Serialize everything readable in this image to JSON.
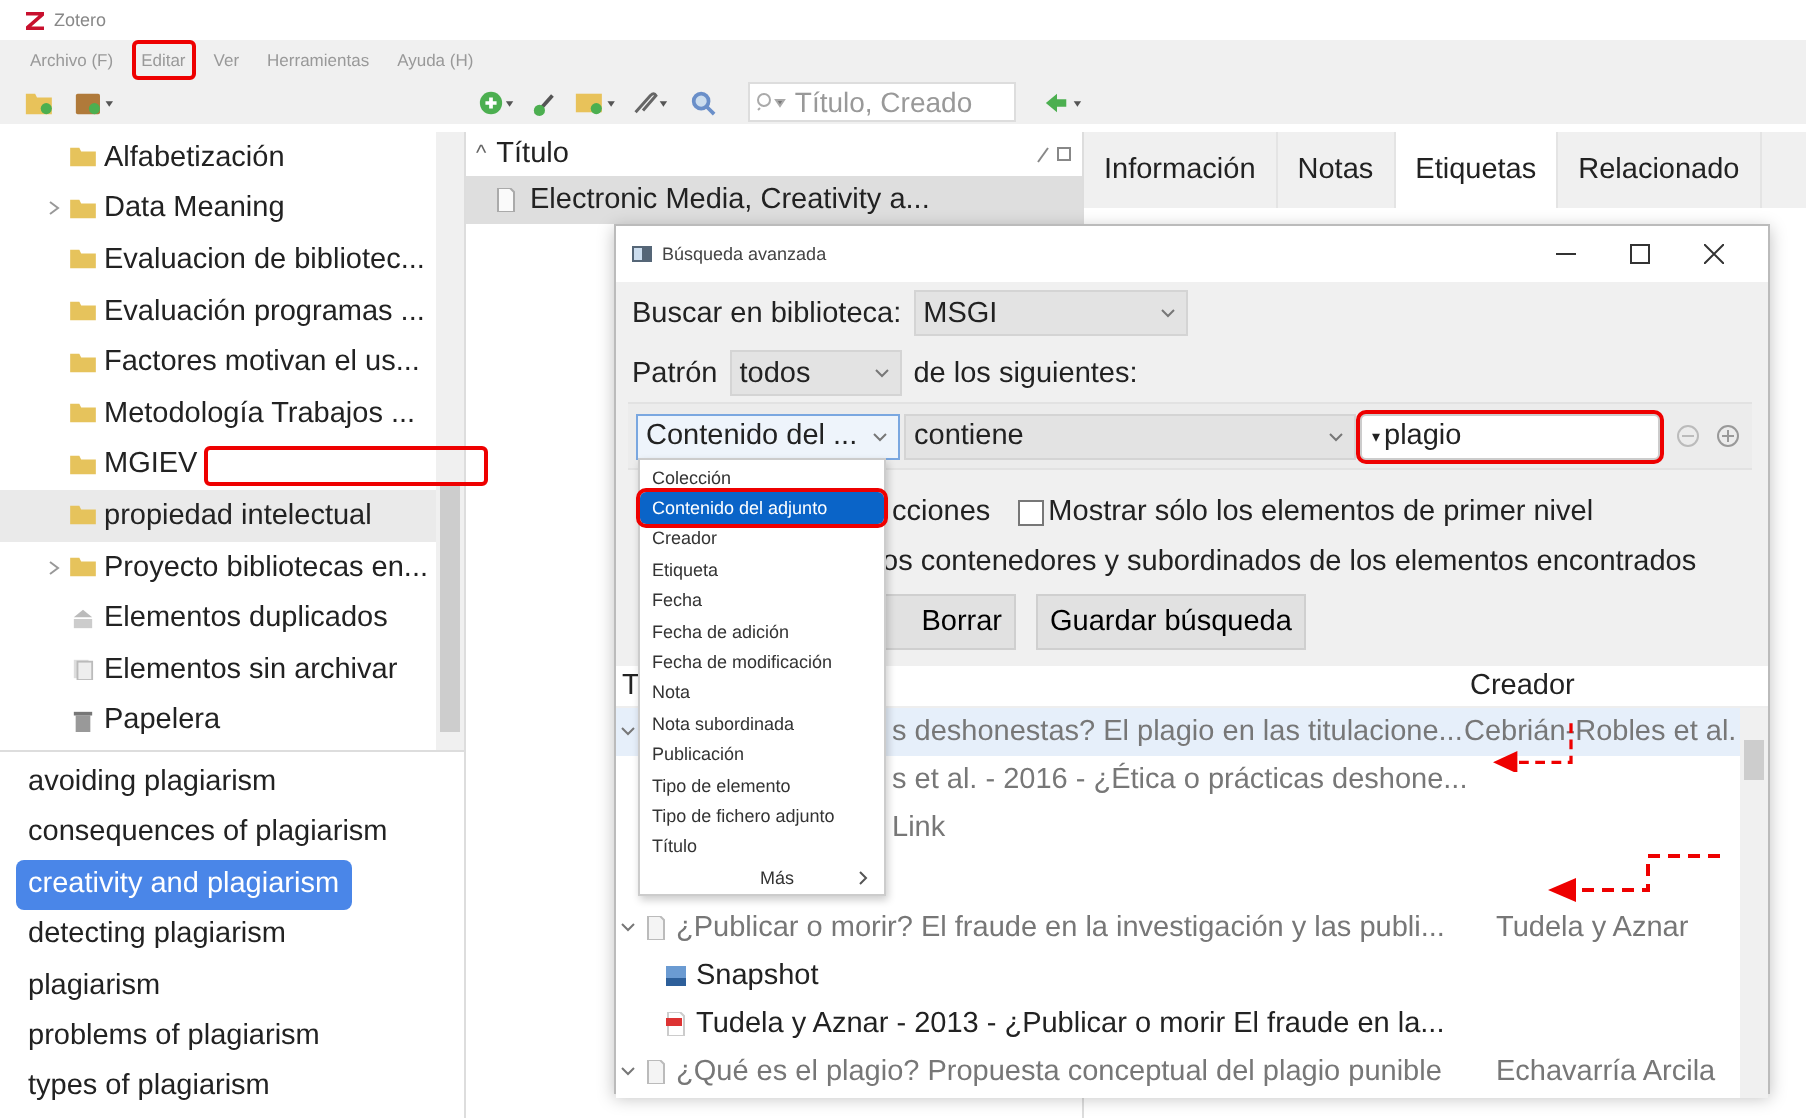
{
  "app_title": "Zotero",
  "menu": [
    {
      "label": "Archivo (F)",
      "highlighted": false
    },
    {
      "label": "Editar",
      "highlighted": true
    },
    {
      "label": "Ver",
      "highlighted": false
    },
    {
      "label": "Herramientas",
      "highlighted": false
    },
    {
      "label": "Ayuda (H)",
      "highlighted": false
    }
  ],
  "search": {
    "placeholder": "Título, Creado"
  },
  "collections": [
    {
      "label": "Alfabetización",
      "kind": "folder",
      "expandable": false,
      "selected": false,
      "highlighted": false
    },
    {
      "label": "Data Meaning",
      "kind": "folder",
      "expandable": true,
      "selected": false,
      "highlighted": false
    },
    {
      "label": "Evaluacion de bibliotec...",
      "kind": "folder",
      "expandable": false,
      "selected": false,
      "highlighted": false
    },
    {
      "label": "Evaluación programas ...",
      "kind": "folder",
      "expandable": false,
      "selected": false,
      "highlighted": false
    },
    {
      "label": "Factores motivan el us...",
      "kind": "folder",
      "expandable": false,
      "selected": false,
      "highlighted": false
    },
    {
      "label": "Metodología Trabajos ...",
      "kind": "folder",
      "expandable": false,
      "selected": false,
      "highlighted": false
    },
    {
      "label": "MGIEV",
      "kind": "folder",
      "expandable": false,
      "selected": false,
      "highlighted": true
    },
    {
      "label": "propiedad intelectual",
      "kind": "folder",
      "expandable": false,
      "selected": true,
      "highlighted": false
    },
    {
      "label": "Proyecto bibliotecas en...",
      "kind": "folder",
      "expandable": true,
      "selected": false,
      "highlighted": false
    },
    {
      "label": "Elementos duplicados",
      "kind": "duplicates",
      "expandable": false,
      "selected": false,
      "highlighted": false
    },
    {
      "label": "Elementos sin archivar",
      "kind": "unfiled",
      "expandable": false,
      "selected": false,
      "highlighted": false
    },
    {
      "label": "Papelera",
      "kind": "trash",
      "expandable": false,
      "selected": false,
      "highlighted": false
    }
  ],
  "tags": [
    {
      "label": "avoiding plagiarism",
      "selected": false
    },
    {
      "label": "consequences of plagiarism",
      "selected": false
    },
    {
      "label": "creativity and plagiarism",
      "selected": true
    },
    {
      "label": "detecting plagiarism",
      "selected": false
    },
    {
      "label": "plagiarism",
      "selected": false
    },
    {
      "label": "problems of plagiarism",
      "selected": false
    },
    {
      "label": "types of plagiarism",
      "selected": false
    }
  ],
  "items_pane": {
    "column": "Título",
    "sort_mark": "^",
    "rows": [
      {
        "title": "Electronic Media, Creativity a...",
        "selected": true
      }
    ]
  },
  "item_tabs": [
    {
      "label": "Información",
      "selected": false
    },
    {
      "label": "Notas",
      "selected": false
    },
    {
      "label": "Etiquetas",
      "selected": true
    },
    {
      "label": "Relacionado",
      "selected": false
    }
  ],
  "dialog": {
    "title": "Búsqueda avanzada",
    "library_label": "Buscar en biblioteca:",
    "library": "MSGI",
    "pattern_label": "Patrón",
    "pattern": "todos",
    "pattern_suffix": "de los siguientes:",
    "condition": {
      "field": "Contenido del ...",
      "operator": "contiene",
      "value": "plagio",
      "mode_marker": "▾",
      "highlighted": true
    },
    "field_menu": [
      {
        "label": "Colección",
        "selected": false,
        "highlighted": false,
        "submenu": false
      },
      {
        "label": "Contenido del adjunto",
        "selected": true,
        "highlighted": true,
        "submenu": false
      },
      {
        "label": "Creador",
        "selected": false,
        "highlighted": false,
        "submenu": false
      },
      {
        "label": "Etiqueta",
        "selected": false,
        "highlighted": false,
        "submenu": false
      },
      {
        "label": "Fecha",
        "selected": false,
        "highlighted": false,
        "submenu": false
      },
      {
        "label": "Fecha de adición",
        "selected": false,
        "highlighted": false,
        "submenu": false
      },
      {
        "label": "Fecha de modificación",
        "selected": false,
        "highlighted": false,
        "submenu": false
      },
      {
        "label": "Nota",
        "selected": false,
        "highlighted": false,
        "submenu": false
      },
      {
        "label": "Nota subordinada",
        "selected": false,
        "highlighted": false,
        "submenu": false
      },
      {
        "label": "Publicación",
        "selected": false,
        "highlighted": false,
        "submenu": false
      },
      {
        "label": "Tipo de elemento",
        "selected": false,
        "highlighted": false,
        "submenu": false
      },
      {
        "label": "Tipo de fichero adjunto",
        "selected": false,
        "highlighted": false,
        "submenu": false
      },
      {
        "label": "Título",
        "selected": false,
        "highlighted": false,
        "submenu": false
      },
      {
        "label": "Más",
        "selected": false,
        "highlighted": false,
        "submenu": true
      }
    ],
    "options": [
      {
        "label": "cciones"
      },
      {
        "label": "Mostrar sólo los elementos de primer nivel",
        "checked": false
      },
      {
        "label": "os contenedores y subordinados de los elementos encontrados"
      }
    ],
    "buttons": [
      "Borrar",
      "Guardar búsqueda"
    ],
    "results": {
      "columns": [
        "T",
        "Creador"
      ],
      "groups": [
        {
          "title": "s deshonestas? El plagio en las titulacione...",
          "creator": "Cebrián-Robles et al.",
          "matched": false,
          "selected": true,
          "children": [
            {
              "title": "s et al. - 2016 - ¿Ética o prácticas deshone...",
              "matched": false,
              "marked": true
            },
            {
              "title": "Link",
              "matched": false
            }
          ]
        },
        {
          "title": "¿Publicar o morir? El fraude en la investigación y las publi...",
          "creator": "Tudela y Aznar",
          "kind": "document",
          "matched": false,
          "selected": false,
          "marked": true,
          "children": [
            {
              "title": "Snapshot",
              "kind": "snapshot",
              "matched": true
            },
            {
              "title": "Tudela y Aznar - 2013 - ¿Publicar o morir El fraude en la...",
              "kind": "pdf",
              "matched": true
            }
          ]
        },
        {
          "title": "¿Qué es el plagio? Propuesta conceptual del plagio punible",
          "creator": "Echavarría Arcila",
          "kind": "document",
          "matched": false,
          "selected": false
        }
      ]
    }
  }
}
